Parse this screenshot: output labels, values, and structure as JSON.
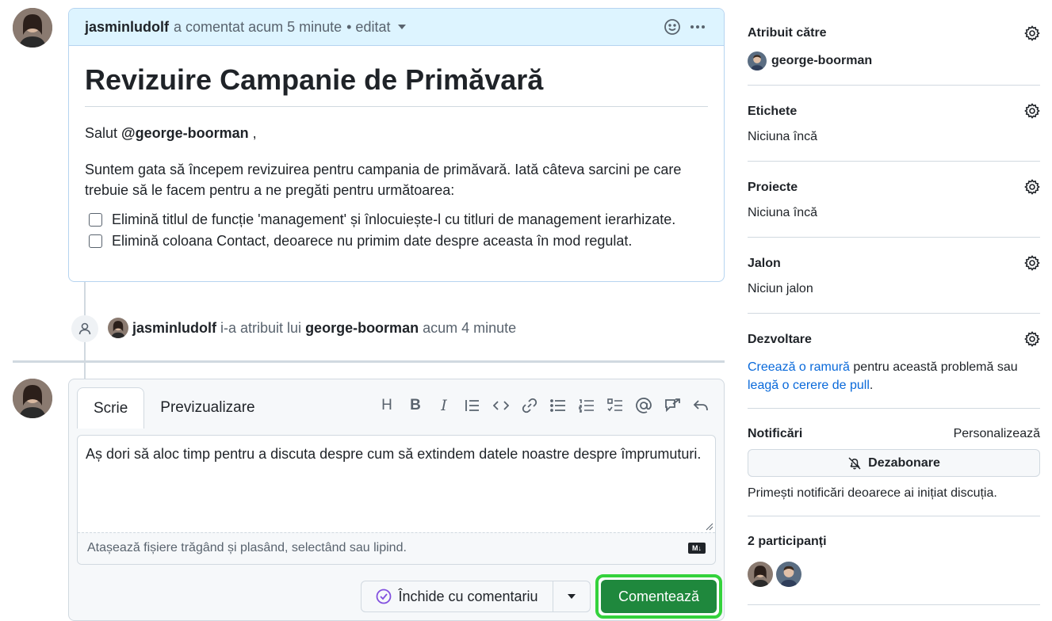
{
  "comment": {
    "author": "jasminludolf",
    "meta": "a comentat acum 5 minute",
    "edited": "• editat",
    "title": "Revizuire Campanie de Primăvară",
    "greeting_prefix": "Salut ",
    "greeting_mention": "@george-boorman",
    "greeting_suffix": " ,",
    "paragraph": "Suntem gata să începem revizuirea pentru campania de primăvară. Iată câteva sarcini pe care trebuie să le facem pentru a ne pregăti pentru următoarea:",
    "tasks": [
      "Elimină titlul de funcție 'management' și înlocuiește-l cu titluri de management ierarhizate.",
      "Elimină coloana Contact, deoarece nu primim date despre aceasta în mod regulat."
    ]
  },
  "event": {
    "actor": "jasminludolf",
    "action": "i-a atribuit lui",
    "target": "george-boorman",
    "time": "acum 4 minute"
  },
  "editor": {
    "tab_write": "Scrie",
    "tab_preview": "Previzualizare",
    "text": "Aș dori să aloc timp pentru a discuta despre cum să extindem datele noastre despre împrumuturi.",
    "attach_hint": "Atașează fișiere trăgând și plasând, selectând sau lipind.",
    "md_badge": "M↓",
    "close_label": "Închide cu comentariu",
    "comment_label": "Comentează",
    "toolbar_heading": "H",
    "toolbar_bold": "B",
    "toolbar_italic": "I"
  },
  "sidebar": {
    "assignees": {
      "title": "Atribuit către",
      "value": "george-boorman"
    },
    "labels": {
      "title": "Etichete",
      "value": "Niciuna încă"
    },
    "projects": {
      "title": "Proiecte",
      "value": "Niciuna încă"
    },
    "milestone": {
      "title": "Jalon",
      "value": "Niciun jalon"
    },
    "development": {
      "title": "Dezvoltare",
      "link1": "Creează o ramură",
      "text1": " pentru această problemă sau ",
      "link2": "leagă o cerere de pull",
      "text2": "."
    },
    "notifications": {
      "title": "Notificări",
      "customize": "Personalizează",
      "unsubscribe": "Dezabonare",
      "reason": "Primești notificări deoarece ai inițiat discuția."
    },
    "participants": {
      "title": "2 participanți"
    }
  },
  "colors": {
    "accent_blue": "#0969da",
    "comment_green": "#1f883d",
    "highlight": "#34d23c",
    "header_blue": "#ddf4ff"
  }
}
